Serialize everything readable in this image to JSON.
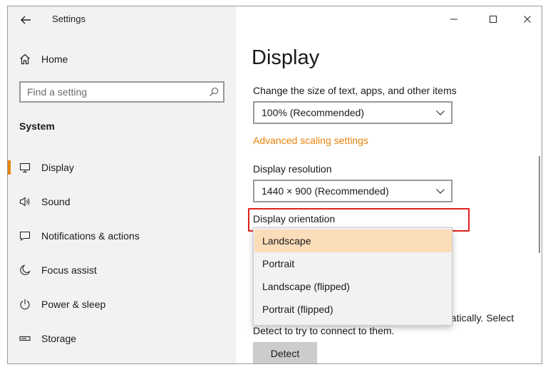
{
  "app": {
    "title": "Settings"
  },
  "sidebar": {
    "home_label": "Home",
    "search_placeholder": "Find a setting",
    "section_heading": "System",
    "items": [
      {
        "label": "Display",
        "icon": "monitor-icon",
        "active": true
      },
      {
        "label": "Sound",
        "icon": "speaker-icon",
        "active": false
      },
      {
        "label": "Notifications & actions",
        "icon": "notification-icon",
        "active": false
      },
      {
        "label": "Focus assist",
        "icon": "moon-icon",
        "active": false
      },
      {
        "label": "Power & sleep",
        "icon": "power-icon",
        "active": false
      },
      {
        "label": "Storage",
        "icon": "storage-icon",
        "active": false
      }
    ]
  },
  "main": {
    "title": "Display",
    "scale_label": "Change the size of text, apps, and other items",
    "scale_value": "100% (Recommended)",
    "advanced_link": "Advanced scaling settings",
    "resolution_label": "Display resolution",
    "resolution_value": "1440 × 900 (Recommended)",
    "orientation_label": "Display orientation",
    "orientation_options": [
      "Landscape",
      "Portrait",
      "Landscape (flipped)",
      "Portrait (flipped)"
    ],
    "orientation_selected": "Landscape",
    "partial_text_1": "matically. Select",
    "partial_text_2": "Detect to try to connect to them.",
    "detect_button": "Detect"
  },
  "colors": {
    "accent": "#e8820c",
    "selected_option_bg": "#fbddb9",
    "highlight_box": "#e0201e",
    "sidebar_bg": "#f2f2f2"
  }
}
